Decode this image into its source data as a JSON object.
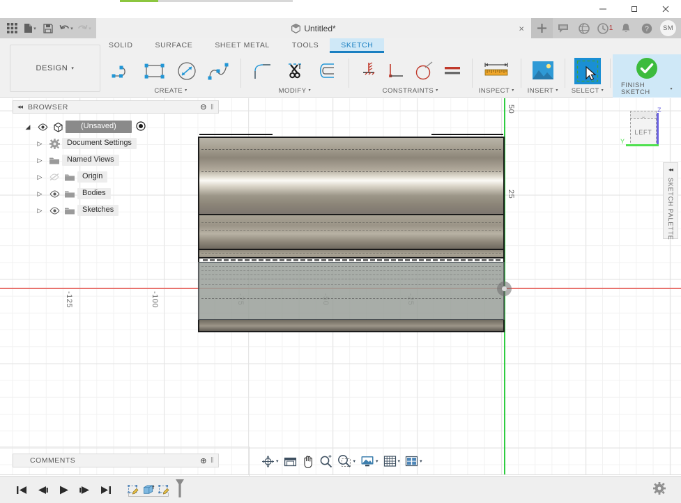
{
  "os_window": {
    "minimize_label": "minimize-icon",
    "maximize_label": "restore-icon",
    "close_label": "close-icon"
  },
  "titlebar": {
    "grid_icon": "app-grid-icon",
    "new_icon": "new-document-icon",
    "save_icon": "save-icon",
    "undo_icon": "undo-icon",
    "redo_icon": "redo-icon",
    "document_title": "Untitled*",
    "document_close": "×",
    "plus_label": "+",
    "notification_count": "1",
    "avatar_initials": "SM"
  },
  "ribbon": {
    "workspace": "DESIGN",
    "workspace_caret": "▾",
    "tabs": [
      {
        "label": "SOLID",
        "active": false
      },
      {
        "label": "SURFACE",
        "active": false
      },
      {
        "label": "SHEET METAL",
        "active": false
      },
      {
        "label": "TOOLS",
        "active": false
      },
      {
        "label": "SKETCH",
        "active": true
      }
    ],
    "panels": [
      {
        "caption": "CREATE",
        "caret": "▾",
        "tools": [
          "line-icon",
          "rectangle-icon",
          "circle-icon",
          "spline-icon"
        ]
      },
      {
        "caption": "MODIFY",
        "caret": "▾",
        "tools": [
          "fillet-icon",
          "trim-scissors-icon",
          "offset-icon"
        ]
      },
      {
        "caption": "CONSTRAINTS",
        "caret": "▾",
        "tools": [
          "ground-constraint-icon",
          "perpendicular-icon",
          "tangent-icon",
          "equal-icon"
        ]
      },
      {
        "caption": "INSPECT",
        "caret": "▾",
        "tools": [
          "measure-ruler-icon"
        ]
      },
      {
        "caption": "INSERT",
        "caret": "▾",
        "tools": [
          "insert-image-icon"
        ]
      },
      {
        "caption": "SELECT",
        "caret": "▾",
        "tools": [
          "select-cursor-icon"
        ]
      },
      {
        "caption": "FINISH SKETCH",
        "caret": "▾",
        "tools": [
          "finish-check-icon"
        ]
      }
    ]
  },
  "browser": {
    "title": "BROWSER",
    "collapse_icon": "◂◂",
    "add_icon": "⊖",
    "grip_icon": "‖",
    "tree": [
      {
        "label": "(Unsaved)",
        "level": 0,
        "arrow": "◢",
        "eye": true,
        "icon": "component-icon",
        "radio": true
      },
      {
        "label": "Document Settings",
        "level": 1,
        "arrow": "▷",
        "eye": false,
        "icon": "gear-icon",
        "radio": false
      },
      {
        "label": "Named Views",
        "level": 1,
        "arrow": "▷",
        "eye": false,
        "icon": "folder-icon",
        "radio": false
      },
      {
        "label": "Origin",
        "level": 1,
        "arrow": "▷",
        "eye": true,
        "eye_off": true,
        "icon": "folder-icon",
        "radio": false
      },
      {
        "label": "Bodies",
        "level": 1,
        "arrow": "▷",
        "eye": true,
        "icon": "folder-icon",
        "radio": false
      },
      {
        "label": "Sketches",
        "level": 1,
        "arrow": "▷",
        "eye": true,
        "icon": "folder-icon",
        "radio": false
      }
    ]
  },
  "comments": {
    "title": "COMMENTS",
    "add_icon": "⊕",
    "grip_icon": "‖"
  },
  "canvas": {
    "ruler_ticks_x": [
      "-125",
      "-100",
      "-75",
      "-50",
      "-25"
    ],
    "ruler_ticks_y": [
      "50",
      "25"
    ],
    "axis_x_color": "#e8736e",
    "axis_y_color": "#2ecc40",
    "view_cube": {
      "face_label": "LEFT",
      "top_label": "⎵",
      "z_label": "Z",
      "y_label": "Y"
    },
    "sketch_palette": {
      "title": "SKETCH PALETTE",
      "collapse_icon": "◂◂"
    }
  },
  "navbar": {
    "items": [
      {
        "name": "orbit-icon",
        "caret": "▾"
      },
      {
        "name": "look-at-icon",
        "caret": ""
      },
      {
        "name": "pan-hand-icon",
        "caret": ""
      },
      {
        "name": "zoom-icon",
        "caret": ""
      },
      {
        "name": "zoom-window-icon",
        "caret": "▾"
      },
      {
        "name": "display-settings-icon",
        "caret": "▾"
      },
      {
        "name": "grid-snap-icon",
        "caret": "▾"
      },
      {
        "name": "viewports-icon",
        "caret": "▾"
      }
    ]
  },
  "statusbar": {
    "timeline": [
      {
        "name": "go-to-beginning-icon"
      },
      {
        "name": "step-back-icon"
      },
      {
        "name": "play-icon"
      },
      {
        "name": "step-forward-icon"
      },
      {
        "name": "go-to-end-icon"
      }
    ],
    "history": [
      {
        "name": "sketch-history-icon"
      },
      {
        "name": "extrude-history-icon"
      },
      {
        "name": "sketch2-history-icon"
      }
    ],
    "settings_icon": "gear-icon"
  }
}
